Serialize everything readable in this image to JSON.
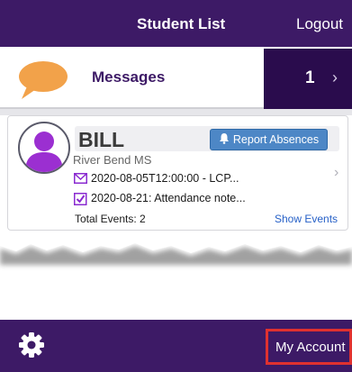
{
  "header": {
    "title": "Student List",
    "logout_label": "Logout"
  },
  "messages": {
    "label": "Messages",
    "count": "1",
    "chevron": "›",
    "icon": "chat-bubble-icon"
  },
  "student_card": {
    "name": "BILL",
    "school": "River Bend MS",
    "report_button_label": "Report Absences",
    "events": [
      {
        "icon": "envelope-icon",
        "text": "2020-08-05T12:00:00 - LCP..."
      },
      {
        "icon": "checkbox-icon",
        "text": "2020-08-21: Attendance note..."
      }
    ],
    "total_events": "Total Events: 2",
    "show_events_label": "Show Events",
    "chevron": "›"
  },
  "footer": {
    "account_label": "My Account",
    "settings_icon": "gear-icon"
  },
  "colors": {
    "brand_purple": "#3d1a66",
    "dark_purple": "#2a0c4d",
    "button_blue": "#4d87c6",
    "link_blue": "#2660c7",
    "highlight_red": "#e0312f",
    "bubble_orange": "#f2a24a"
  }
}
